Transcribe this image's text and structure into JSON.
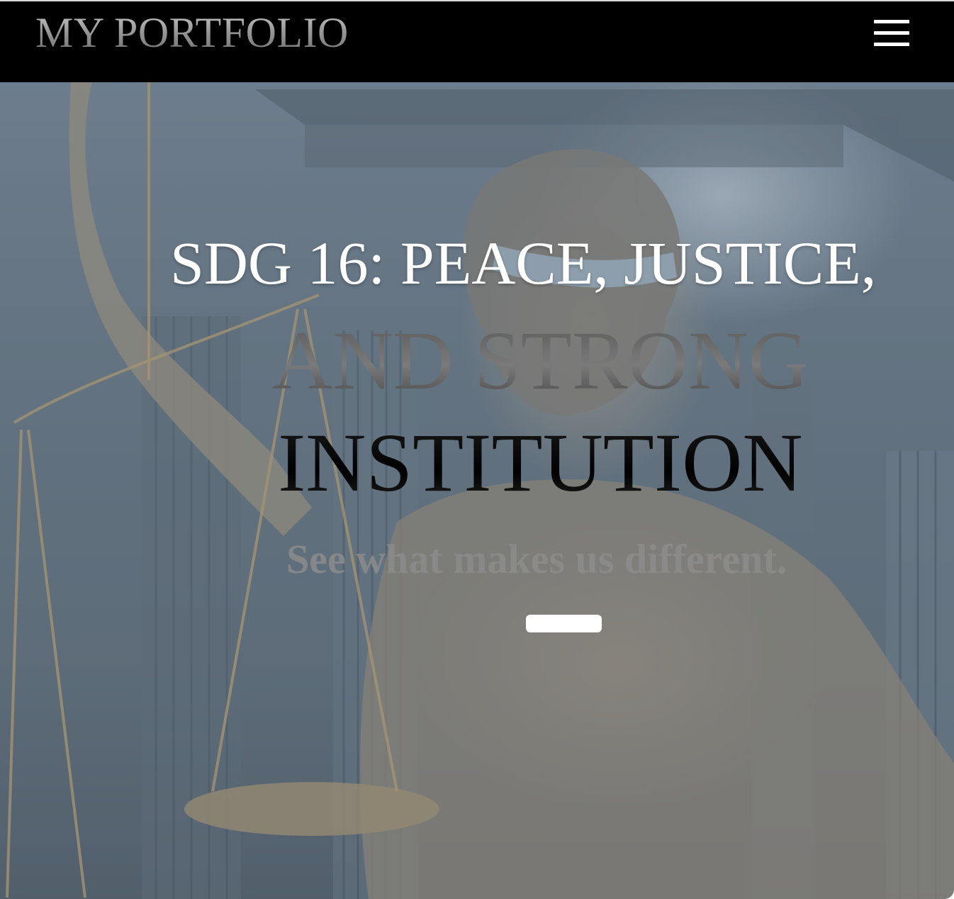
{
  "header": {
    "brand": "MY PORTFOLIO",
    "menu_icon": "hamburger-menu-icon"
  },
  "hero": {
    "headline_line1": "SDG 16: PEACE, JUSTICE,",
    "headline_line2": "AND STRONG",
    "headline_line3": "INSTITUTION",
    "tagline": "See what makes us different.",
    "cta_label": "",
    "background_image": "lady-justice-statue-with-scales-and-blindfold"
  },
  "colors": {
    "header_bg": "#000000",
    "hero_tint": "#53636f",
    "headline_white": "#ffffff",
    "headline_gray": "#6a6a6a",
    "headline_black": "#000000",
    "cta_bg": "#ffffff"
  }
}
